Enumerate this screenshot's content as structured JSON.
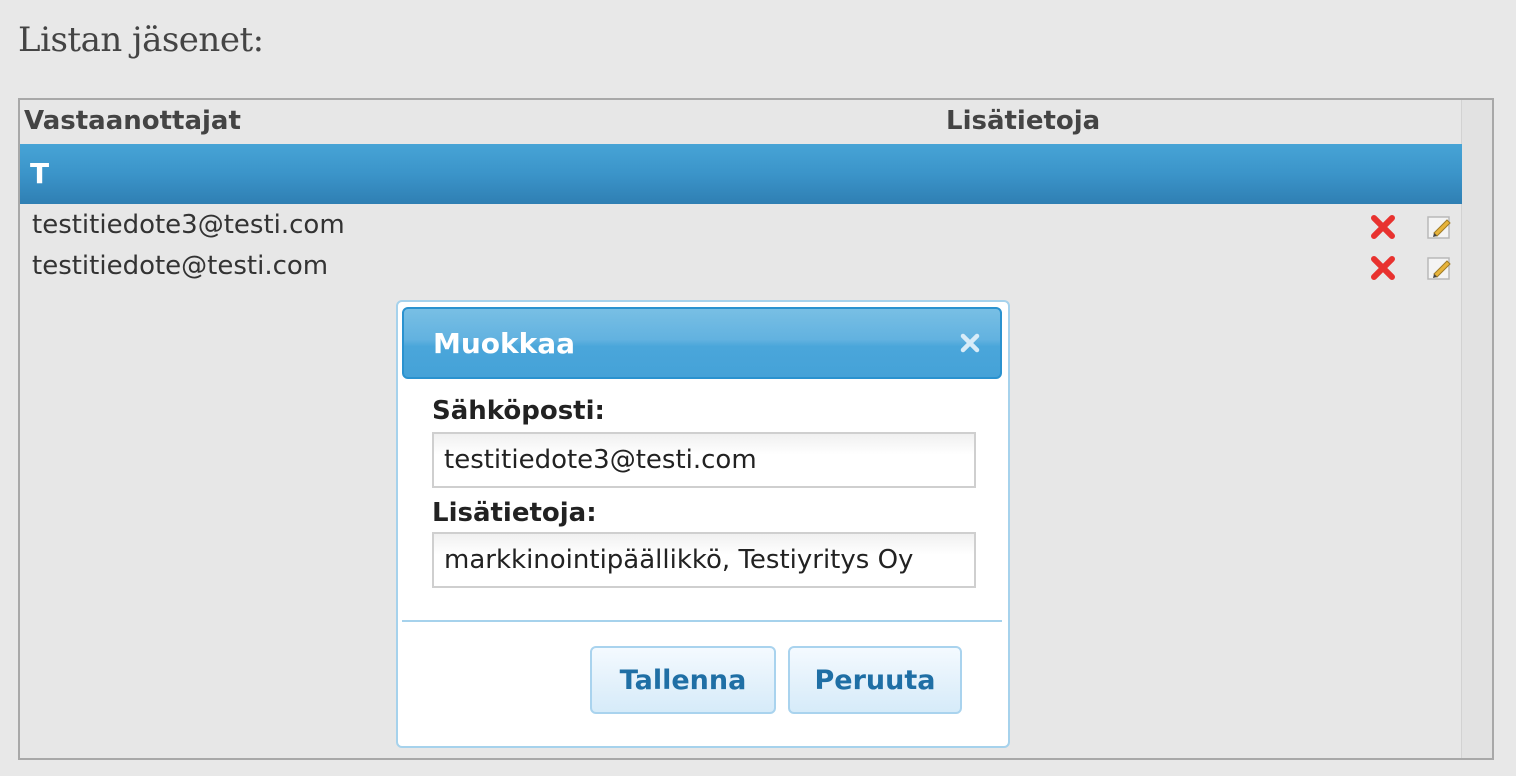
{
  "page": {
    "title": "Listan jäsenet:"
  },
  "table": {
    "columns": {
      "recipients": "Vastaanottajat",
      "info": "Lisätietoja"
    },
    "group": {
      "letter": "T"
    },
    "rows": [
      {
        "email": "testitiedote3@testi.com"
      },
      {
        "email": "testitiedote@testi.com"
      }
    ]
  },
  "dialog": {
    "title": "Muokkaa",
    "email_label": "Sähköposti:",
    "email_value": "testitiedote3@testi.com",
    "info_label": "Lisätietoja:",
    "info_value": "markkinointipäällikkö, Testiyritys Oy",
    "save_label": "Tallenna",
    "cancel_label": "Peruuta"
  },
  "colors": {
    "group_header": "#3b94c9",
    "delete_icon": "#e8322f",
    "button_text": "#1f6fa5"
  },
  "icons": {
    "delete": "delete-x-icon",
    "edit": "pencil-edit-icon",
    "close": "close-icon"
  }
}
